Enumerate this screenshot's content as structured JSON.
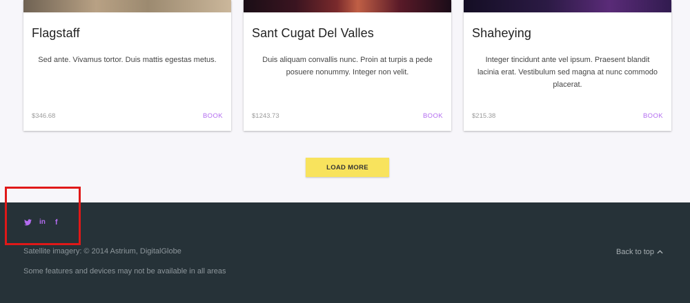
{
  "cards": [
    {
      "title": "Flagstaff",
      "description": "Sed ante. Vivamus tortor. Duis mattis egestas metus.",
      "price": "$346.68",
      "action": "BOOK"
    },
    {
      "title": "Sant Cugat Del Valles",
      "description": "Duis aliquam convallis nunc. Proin at turpis a pede posuere nonummy. Integer non velit.",
      "price": "$1243.73",
      "action": "BOOK"
    },
    {
      "title": "Shaheying",
      "description": "Integer tincidunt ante vel ipsum. Praesent blandit lacinia erat. Vestibulum sed magna at nunc commodo placerat.",
      "price": "$215.38",
      "action": "BOOK"
    }
  ],
  "load_more_label": "LOAD MORE",
  "footer": {
    "social": {
      "twitter_icon": "twitter-icon",
      "linkedin_label": "in",
      "facebook_label": "f"
    },
    "credits": "Satellite imagery: © 2014 Astrium, DigitalGlobe",
    "disclaimer": "Some features and devices may not be available in all areas",
    "back_to_top_label": "Back to top"
  },
  "colors": {
    "accent": "#b36cf0",
    "load_more_bg": "#f8e35d",
    "footer_bg": "#263238",
    "page_bg": "#f7f6fa",
    "highlight": "#e01818"
  }
}
